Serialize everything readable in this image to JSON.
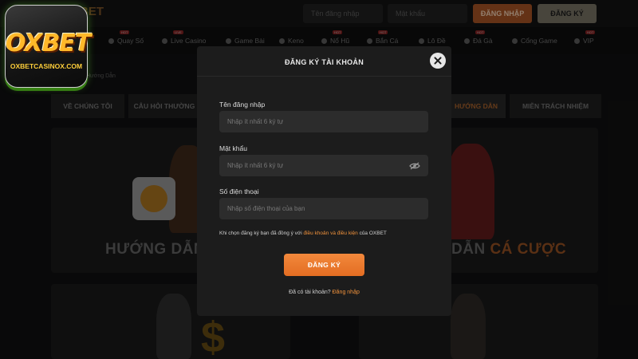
{
  "header": {
    "brand": "BET",
    "username_placeholder": "Tên đăng nhập",
    "password_placeholder": "Mật khẩu",
    "login_label": "ĐĂNG NHẬP",
    "register_label": "ĐĂNG KÝ"
  },
  "nav": {
    "items": [
      {
        "label": "Quay Số",
        "badge": "HOT"
      },
      {
        "label": "Live Casino",
        "badge": "LIVE"
      },
      {
        "label": "Game Bài",
        "badge": ""
      },
      {
        "label": "Keno",
        "badge": ""
      },
      {
        "label": "Nổ Hũ",
        "badge": "HOT"
      },
      {
        "label": "Bắn Cá",
        "badge": "HOT"
      },
      {
        "label": "Lô Đề",
        "badge": ""
      },
      {
        "label": "Đá Gà",
        "badge": "HOT"
      },
      {
        "label": "Cổng Game",
        "badge": ""
      },
      {
        "label": "VIP",
        "badge": "HOT"
      }
    ]
  },
  "breadcrumb": "Hướng Dẫn",
  "tabs": [
    "VỀ CHÚNG TÔI",
    "CÂU HỎI THƯỜNG",
    "HƯỚNG DẪN",
    "MIỄN TRÁCH NHIỆM"
  ],
  "banners": {
    "left_text": "HƯỚNG DẪN",
    "right_text_plain": "DẪN ",
    "right_text_highlight": "CÁ CƯỢC"
  },
  "logo": {
    "main": "OXBET",
    "sub": "OXBETCASINOX.COM"
  },
  "modal": {
    "title": "ĐĂNG KÝ TÀI KHOẢN",
    "username_label": "Tên đăng nhập",
    "username_placeholder": "Nhập ít nhất 6 ký tự",
    "password_label": "Mật khẩu",
    "password_placeholder": "Nhập ít nhất 6 ký tự",
    "phone_label": "Số điện thoại",
    "phone_placeholder": "Nhập số điện thoại của bạn",
    "terms_prefix": "Khi chọn đăng ký bạn đã đồng ý với ",
    "terms_link": "điều khoản và điều kiện",
    "terms_suffix": " của OXBET",
    "submit_label": "ĐĂNG KÝ",
    "login_prompt": "Đã có tài khoản? ",
    "login_link": "Đăng nhập"
  },
  "colors": {
    "accent": "#ee7b2e",
    "modal_bg": "#1c1c1c",
    "input_bg": "#2c2c2c",
    "logo_gold": "#ffb829"
  }
}
